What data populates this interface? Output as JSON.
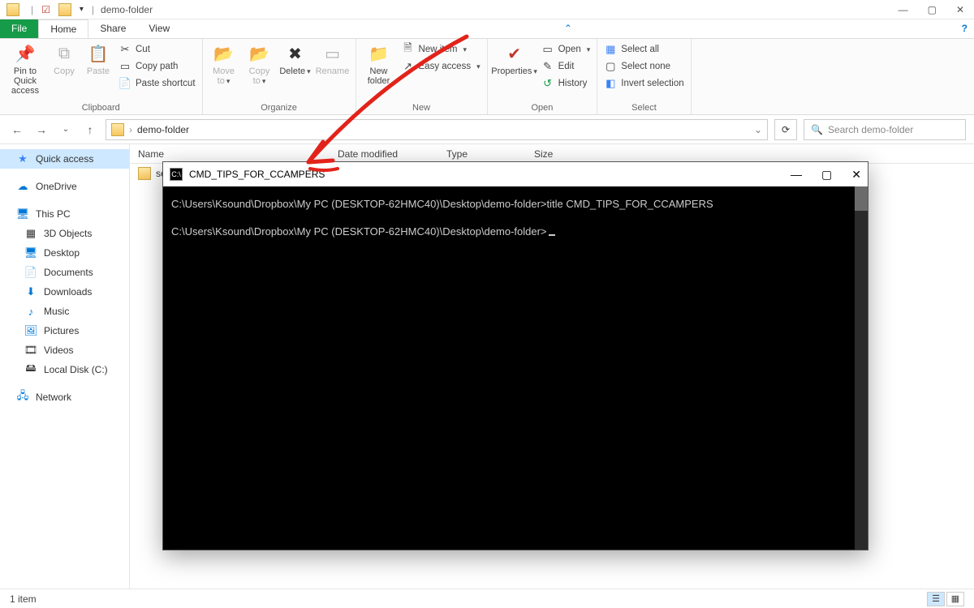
{
  "titlebar": {
    "title": "demo-folder"
  },
  "wincontrols": {
    "min": "—",
    "max": "▢",
    "close": "✕"
  },
  "tabs": {
    "file": "File",
    "home": "Home",
    "share": "Share",
    "view": "View"
  },
  "ribbon": {
    "clipboard": {
      "pin": "Pin to Quick access",
      "copy": "Copy",
      "paste": "Paste",
      "cut": "Cut",
      "copypath": "Copy path",
      "pasteshort": "Paste shortcut",
      "label": "Clipboard"
    },
    "organize": {
      "moveto": "Move to",
      "copyto": "Copy to",
      "delete": "Delete",
      "rename": "Rename",
      "label": "Organize"
    },
    "new": {
      "newfolder": "New folder",
      "newitem": "New item",
      "easyaccess": "Easy access",
      "label": "New"
    },
    "open": {
      "properties": "Properties",
      "open": "Open",
      "edit": "Edit",
      "history": "History",
      "label": "Open"
    },
    "select": {
      "all": "Select all",
      "none": "Select none",
      "invert": "Invert selection",
      "label": "Select"
    }
  },
  "nav": {
    "breadcrumb": "demo-folder",
    "search_placeholder": "Search demo-folder"
  },
  "columns": {
    "name": "Name",
    "date": "Date modified",
    "type": "Type",
    "size": "Size"
  },
  "file": {
    "name": "se"
  },
  "sidebar": {
    "quick": "Quick access",
    "onedrive": "OneDrive",
    "thispc": "This PC",
    "items": [
      "3D Objects",
      "Desktop",
      "Documents",
      "Downloads",
      "Music",
      "Pictures",
      "Videos",
      "Local Disk (C:)"
    ],
    "network": "Network"
  },
  "status": {
    "text": "1 item"
  },
  "cmd": {
    "title": "CMD_TIPS_FOR_CCAMPERS",
    "line1_prompt": "C:\\Users\\Ksound\\Dropbox\\My PC (DESKTOP-62HMC40)\\Desktop\\demo-folder>",
    "line1_cmd": "title CMD_TIPS_FOR_CCAMPERS",
    "line2_prompt": "C:\\Users\\Ksound\\Dropbox\\My PC (DESKTOP-62HMC40)\\Desktop\\demo-folder>"
  }
}
